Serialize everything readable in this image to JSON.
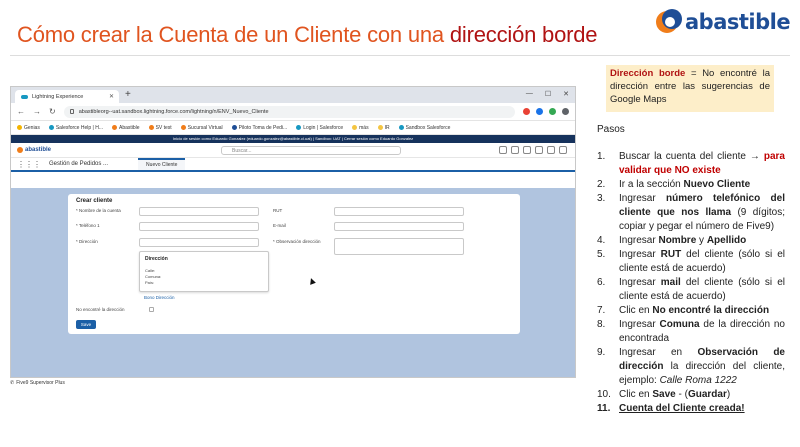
{
  "slide": {
    "title_prefix": "Cómo crear la Cuenta de un Cliente con una ",
    "title_highlight": "dirección borde",
    "logo_text": "abastible",
    "colors": {
      "title": "#e0541f",
      "highlight": "#b01313",
      "logo_blue": "#1f4e96",
      "logo_orange": "#f07d1a",
      "callout_bg": "#fdeec9"
    }
  },
  "browser": {
    "tab_title": "Lightning Experience",
    "url": "abastibleorg--uat.sandbox.lightning.force.com/lightning/n/ENV_Nuevo_Cliente",
    "bookmarks": [
      "Genias",
      "Salesforce Help | H...",
      "Abastible",
      "SV test",
      "Sucursal Virtual",
      "Piloto Toma de Pedi...",
      "Login | Salesforce",
      "más",
      "IR",
      "Sandbox Salesforce"
    ],
    "sf_banner": "Inicio de sesión como Eduardo Gonzalez (eduardo.gonzalez@abastible.cl.uat) | Sandbox: UAT | Cerrar sesión como Eduardo Gonzalez",
    "sf_logo": "abastible",
    "search_placeholder": "Buscar...",
    "app_name": "Gestión de Pedidos ...",
    "app_tab": "Nuevo Cliente",
    "form": {
      "title": "Crear cliente",
      "name_label": "* Nombre de la cuenta",
      "rut_label": "RUT",
      "phone_label": "* Teléfono 1",
      "email_label": "E-mail",
      "address_label": "* Dirección",
      "observation_label": "* Observación dirección",
      "dropdown_heading": "Dirección",
      "dropdown_items": [
        "Calle:",
        "Comuna:",
        "País:"
      ],
      "bono_link": "Bono Dirección",
      "checkbox_label": "No encontré la dirección",
      "save_label": "Save"
    },
    "utility_bar": "Five9 Supervisor Plus"
  },
  "callout": {
    "key": "Dirección borde",
    "text": " = No encontré la dirección entre las sugerencias de Google Maps"
  },
  "instructions": {
    "heading": "Pasos",
    "steps": [
      {
        "num": "1.",
        "a": "Buscar la cuenta del cliente → ",
        "red": "para validar que NO existe"
      },
      {
        "num": "2.",
        "a": "Ir a la sección ",
        "b": "Nuevo Cliente"
      },
      {
        "num": "3.",
        "a": "Ingresar ",
        "b": "número telefónico del cliente que nos llama",
        "c": " (9 dígitos; copiar y pegar el número de Five9)"
      },
      {
        "num": "4.",
        "a": "Ingresar ",
        "b": "Nombre",
        "c": " y ",
        "d": "Apellido"
      },
      {
        "num": "5.",
        "a": "Ingresar ",
        "b": "RUT",
        "c": " del cliente (sólo si el cliente está de acuerdo)"
      },
      {
        "num": "6.",
        "a": "Ingresar ",
        "b": "mail",
        "c": " del cliente (sólo si el cliente está de acuerdo)"
      },
      {
        "num": "7.",
        "a": "Clic en ",
        "b": "No encontré la dirección"
      },
      {
        "num": "8.",
        "a": "Ingresar ",
        "b": "Comuna",
        "c": " de la dirección no encontrada"
      },
      {
        "num": "9.",
        "a": "Ingresar en ",
        "b": "Observación de dirección",
        "c": " la dirección del cliente, ejemplo: ",
        "i": "Calle Roma 1222"
      },
      {
        "num": "10.",
        "a": "Clic en ",
        "b": "Save",
        "c": " - (",
        "d": "Guardar",
        "e": ")"
      },
      {
        "num": "11.",
        "final": "Cuenta del Cliente creada!"
      }
    ]
  }
}
